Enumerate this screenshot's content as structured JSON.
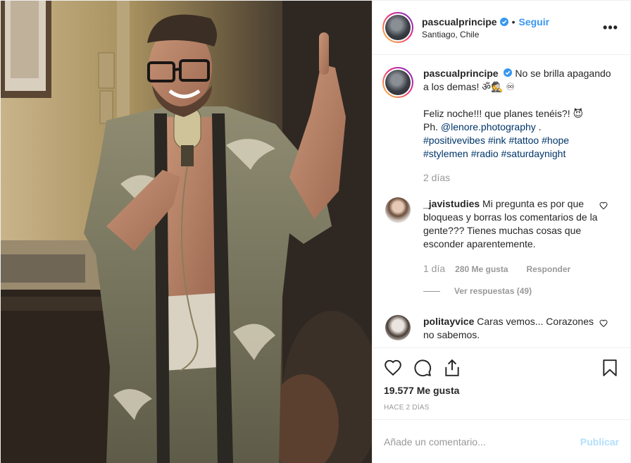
{
  "post": {
    "username": "pascualprincipe",
    "follow_label": "Seguir",
    "separator": "•",
    "location": "Santiago, Chile",
    "more_label": "•••",
    "caption": {
      "username": "pascualprincipe",
      "text_line1": "No se brilla apagando a los demas! ॐ🕵 ♾",
      "text_line2": "Feliz noche!!! que planes tenéis?! 😈",
      "credit_prefix": "Ph. ",
      "credit_mention": "@lenore.photography",
      "credit_suffix": " .",
      "hashtags_line1": [
        "#positivevibes",
        "#ink",
        "#tattoo",
        "#hope"
      ],
      "hashtags_line2": [
        "#stylemen",
        "#radio",
        "#saturdaynight"
      ],
      "time": "2 días"
    },
    "comments": [
      {
        "username": "_javistudies",
        "text": "Mi pregunta es por que bloqueas y borras los comentarios de la gente??? Tienes muchas cosas que esconder aparentemente.",
        "time": "1 día",
        "likes": "280 Me gusta",
        "reply_label": "Responder",
        "view_replies": "Ver respuestas (49)"
      },
      {
        "username": "politayvice",
        "text": "Caras vemos... Corazones no sabemos."
      }
    ],
    "likes": "19.577 Me gusta",
    "time_ago": "HACE 2 DÍAS",
    "comment_placeholder": "Añade un comentario...",
    "publish_label": "Publicar"
  },
  "icons": [
    "verified-badge-icon",
    "heart-icon",
    "comment-icon",
    "share-icon",
    "bookmark-icon",
    "more-options-icon"
  ],
  "colors": {
    "link_blue": "#3897f0",
    "hashtag_blue": "#003569",
    "muted_gray": "#999999",
    "publish_disabled": "#b2dffc"
  }
}
